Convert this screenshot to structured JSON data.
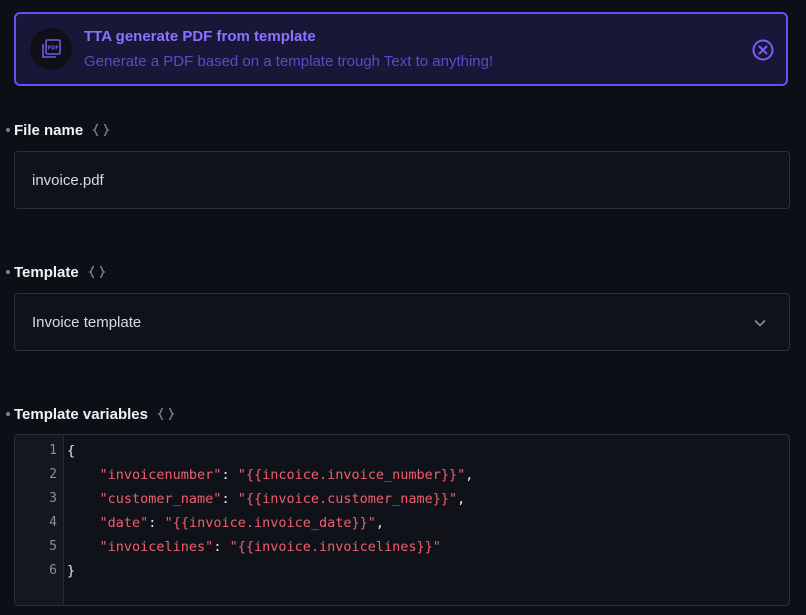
{
  "banner": {
    "title": "TTA generate PDF from template",
    "subtitle": "Generate a PDF based on a template trough Text to anything!",
    "icon": "pdf-stack-icon",
    "close_icon": "close-circle-icon"
  },
  "fields": {
    "file_name": {
      "label": "File name",
      "value": "invoice.pdf"
    },
    "template": {
      "label": "Template",
      "value": "Invoice template"
    },
    "template_variables": {
      "label": "Template variables"
    }
  },
  "editor": {
    "line_numbers": [
      "1",
      "2",
      "3",
      "4",
      "5",
      "6"
    ],
    "lines": [
      [
        {
          "t": "{",
          "c": "punc"
        }
      ],
      [
        {
          "t": "    ",
          "c": "punc"
        },
        {
          "t": "\"invoicenumber\"",
          "c": "key"
        },
        {
          "t": ": ",
          "c": "punc"
        },
        {
          "t": "\"{{incoice.invoice_number}}\"",
          "c": "str"
        },
        {
          "t": ",",
          "c": "punc"
        }
      ],
      [
        {
          "t": "    ",
          "c": "punc"
        },
        {
          "t": "\"customer_name\"",
          "c": "key"
        },
        {
          "t": ": ",
          "c": "punc"
        },
        {
          "t": "\"{{invoice.customer_name}}\"",
          "c": "str"
        },
        {
          "t": ",",
          "c": "punc"
        }
      ],
      [
        {
          "t": "    ",
          "c": "punc"
        },
        {
          "t": "\"date\"",
          "c": "key"
        },
        {
          "t": ": ",
          "c": "punc"
        },
        {
          "t": "\"{{invoice.invoice_date}}\"",
          "c": "str"
        },
        {
          "t": ",",
          "c": "punc"
        }
      ],
      [
        {
          "t": "    ",
          "c": "punc"
        },
        {
          "t": "\"invoicelines\"",
          "c": "key"
        },
        {
          "t": ": ",
          "c": "punc"
        },
        {
          "t": "\"{{invoice.invoicelines}}\"",
          "c": "str"
        }
      ],
      [
        {
          "t": "}",
          "c": "punc"
        }
      ]
    ]
  },
  "colors": {
    "accent": "#6d4df2",
    "banner_title": "#8b73ff",
    "string": "#ef5f6e",
    "background": "#0d0f16"
  }
}
